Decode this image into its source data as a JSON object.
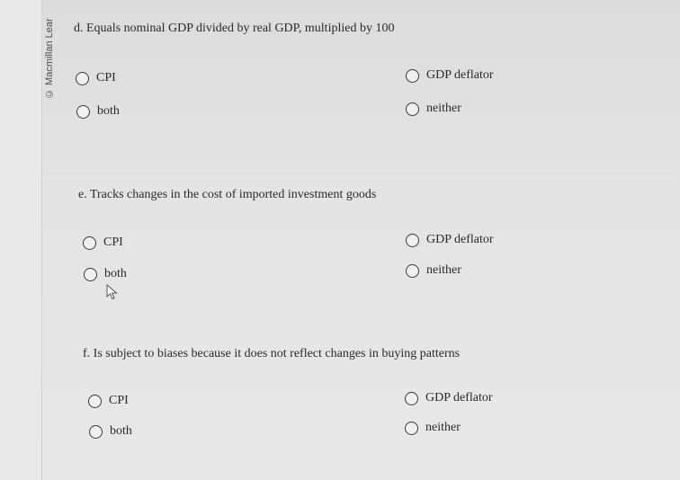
{
  "brand": "© Macmillan Lear",
  "questions": [
    {
      "label": "d. Equals nominal GDP divided by real GDP, multiplied by 100",
      "options": [
        "CPI",
        "GDP deflator",
        "both",
        "neither"
      ]
    },
    {
      "label": "e. Tracks changes in the cost of imported investment goods",
      "options": [
        "CPI",
        "GDP deflator",
        "both",
        "neither"
      ]
    },
    {
      "label": "f. Is subject to biases because it does not reflect changes in buying patterns",
      "options": [
        "CPI",
        "GDP deflator",
        "both",
        "neither"
      ]
    }
  ]
}
